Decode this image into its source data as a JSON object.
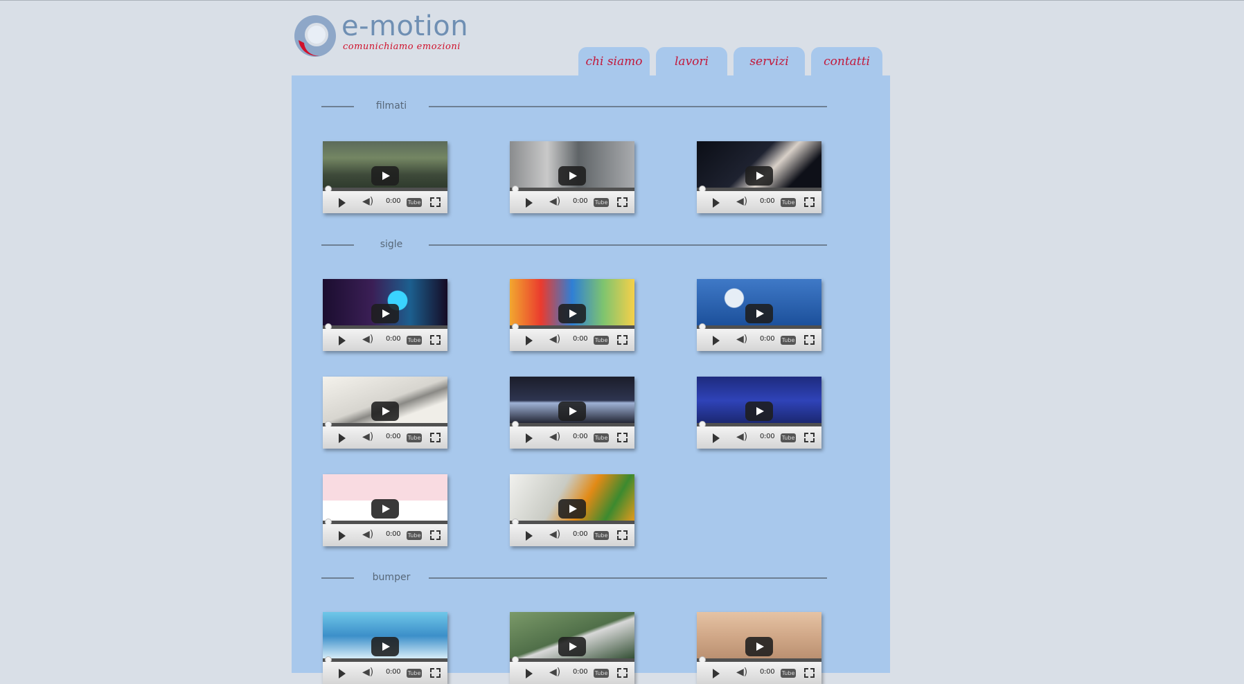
{
  "brand": {
    "name": "e-motion",
    "tagline": "comunichiamo emozioni"
  },
  "nav": [
    {
      "label": "chi siamo"
    },
    {
      "label": "lavori"
    },
    {
      "label": "servizi"
    },
    {
      "label": "contatti"
    }
  ],
  "sections": [
    {
      "title": "filmati"
    },
    {
      "title": "sigle"
    },
    {
      "title": "bumper"
    }
  ],
  "player": {
    "time": "0:00",
    "yt_label": "Tube",
    "volume_glyph": "◀)"
  },
  "colors": {
    "accent": "#c2183a",
    "panel": "#a8c8ec",
    "background": "#d9dfe7"
  }
}
